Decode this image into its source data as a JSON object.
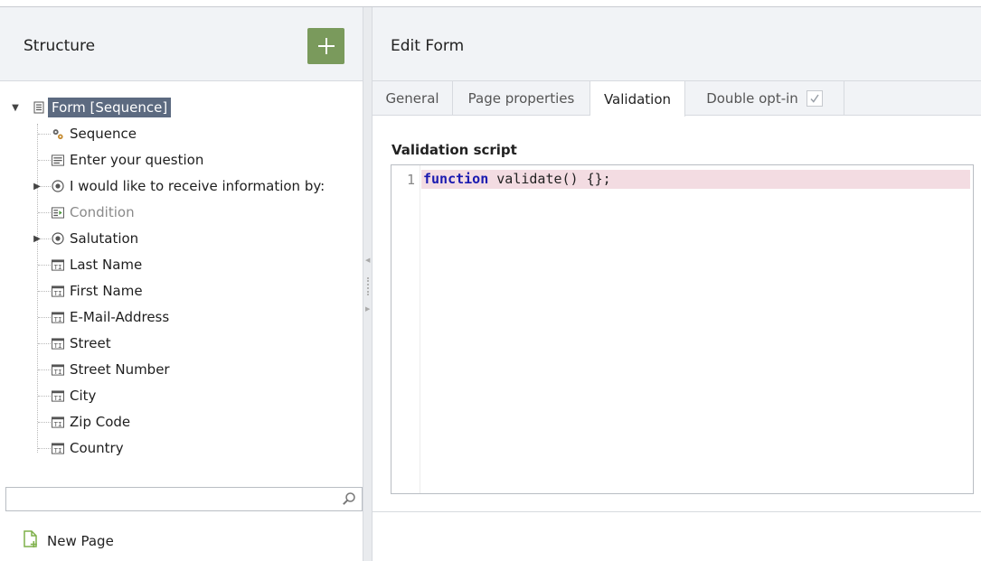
{
  "left": {
    "title": "Structure",
    "add_button": "+",
    "tree": [
      {
        "label": "Form [Sequence]",
        "icon": "form-icon",
        "selected": true,
        "disabled": false,
        "expandable": "open"
      },
      {
        "label": "Sequence",
        "icon": "gears-icon",
        "selected": false,
        "disabled": false,
        "expandable": ""
      },
      {
        "label": "Enter your question",
        "icon": "textarea-icon",
        "selected": false,
        "disabled": false,
        "expandable": ""
      },
      {
        "label": "I would like to receive information by:",
        "icon": "radio-icon",
        "selected": false,
        "disabled": false,
        "expandable": "closed"
      },
      {
        "label": "Condition",
        "icon": "condition-icon",
        "selected": false,
        "disabled": true,
        "expandable": ""
      },
      {
        "label": "Salutation",
        "icon": "radio-icon",
        "selected": false,
        "disabled": false,
        "expandable": "closed"
      },
      {
        "label": "Last Name",
        "icon": "textfield-icon",
        "selected": false,
        "disabled": false,
        "expandable": ""
      },
      {
        "label": "First Name",
        "icon": "textfield-icon",
        "selected": false,
        "disabled": false,
        "expandable": ""
      },
      {
        "label": "E-Mail-Address",
        "icon": "textfield-icon",
        "selected": false,
        "disabled": false,
        "expandable": ""
      },
      {
        "label": "Street",
        "icon": "textfield-icon",
        "selected": false,
        "disabled": false,
        "expandable": ""
      },
      {
        "label": "Street Number",
        "icon": "textfield-icon",
        "selected": false,
        "disabled": false,
        "expandable": ""
      },
      {
        "label": "City",
        "icon": "textfield-icon",
        "selected": false,
        "disabled": false,
        "expandable": ""
      },
      {
        "label": "Zip Code",
        "icon": "textfield-icon",
        "selected": false,
        "disabled": false,
        "expandable": ""
      },
      {
        "label": "Country",
        "icon": "textfield-icon",
        "selected": false,
        "disabled": false,
        "expandable": ""
      }
    ],
    "search": {
      "value": "",
      "placeholder": ""
    },
    "new_page_label": "New Page"
  },
  "right": {
    "title": "Edit Form",
    "tabs": [
      {
        "label": "General",
        "active": false
      },
      {
        "label": "Page properties",
        "active": false
      },
      {
        "label": "Validation",
        "active": true
      },
      {
        "label": "Double opt-in",
        "active": false,
        "checkbox": true,
        "checked": true
      }
    ],
    "section_label": "Validation script",
    "editor": {
      "line_number": "1",
      "keyword": "function",
      "rest": " validate() {};"
    }
  },
  "colors": {
    "add_button": "#7a9a5c",
    "selected_bg": "#5c6a80",
    "header_bg": "#f1f3f6",
    "code_highlight": "#f3dce2",
    "keyword": "#1a1ab0"
  }
}
